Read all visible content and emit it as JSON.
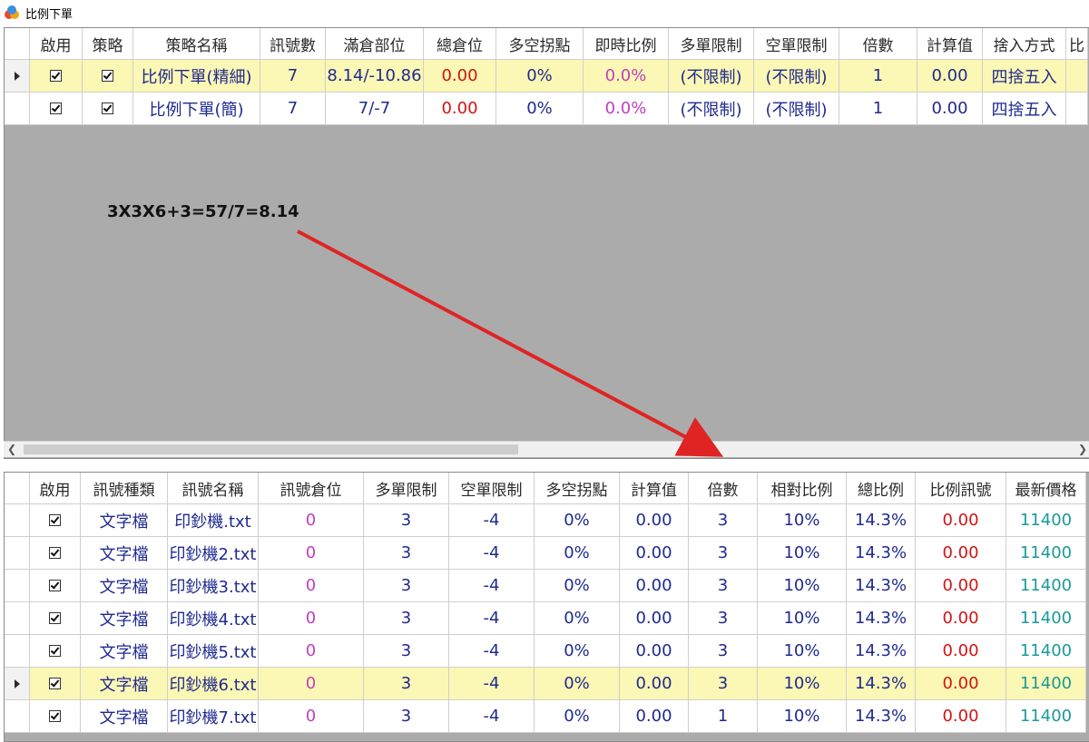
{
  "window": {
    "title": "比例下單"
  },
  "top_table": {
    "headers": [
      "啟用",
      "策略",
      "策略名稱",
      "訊號數",
      "滿倉部位",
      "總倉位",
      "多空拐點",
      "即時比例",
      "多單限制",
      "空單限制",
      "倍數",
      "計算值",
      "捨入方式",
      "比"
    ],
    "rows": [
      {
        "selected": true,
        "enabled": true,
        "strategy": true,
        "name": "比例下單(精細)",
        "signals": "7",
        "full_position": "8.14/-10.86",
        "total_position": "0.00",
        "turn_point": "0%",
        "realtime_ratio": "0.0%",
        "long_limit": "(不限制)",
        "short_limit": "(不限制)",
        "multiplier": "1",
        "calc_value": "0.00",
        "rounding": "四捨五入"
      },
      {
        "selected": false,
        "enabled": true,
        "strategy": true,
        "name": "比例下單(簡)",
        "signals": "7",
        "full_position": "7/-7",
        "total_position": "0.00",
        "turn_point": "0%",
        "realtime_ratio": "0.0%",
        "long_limit": "(不限制)",
        "short_limit": "(不限制)",
        "multiplier": "1",
        "calc_value": "0.00",
        "rounding": "四捨五入"
      }
    ]
  },
  "annotation": {
    "text": "3X3X6+3=57/7=8.14",
    "arrow_color": "#e02424"
  },
  "bottom_table": {
    "headers": [
      "啟用",
      "訊號種類",
      "訊號名稱",
      "訊號倉位",
      "多單限制",
      "空單限制",
      "多空拐點",
      "計算值",
      "倍數",
      "相對比例",
      "總比例",
      "比例訊號",
      "最新價格"
    ],
    "rows": [
      {
        "selected": false,
        "enabled": true,
        "type": "文字檔",
        "name": "印鈔機.txt",
        "position": "0",
        "long_limit": "3",
        "short_limit": "-4",
        "turn_point": "0%",
        "calc_value": "0.00",
        "multiplier": "3",
        "rel_ratio": "10%",
        "total_ratio": "14.3%",
        "ratio_signal": "0.00",
        "latest_price": "11400"
      },
      {
        "selected": false,
        "enabled": true,
        "type": "文字檔",
        "name": "印鈔機2.txt",
        "position": "0",
        "long_limit": "3",
        "short_limit": "-4",
        "turn_point": "0%",
        "calc_value": "0.00",
        "multiplier": "3",
        "rel_ratio": "10%",
        "total_ratio": "14.3%",
        "ratio_signal": "0.00",
        "latest_price": "11400"
      },
      {
        "selected": false,
        "enabled": true,
        "type": "文字檔",
        "name": "印鈔機3.txt",
        "position": "0",
        "long_limit": "3",
        "short_limit": "-4",
        "turn_point": "0%",
        "calc_value": "0.00",
        "multiplier": "3",
        "rel_ratio": "10%",
        "total_ratio": "14.3%",
        "ratio_signal": "0.00",
        "latest_price": "11400"
      },
      {
        "selected": false,
        "enabled": true,
        "type": "文字檔",
        "name": "印鈔機4.txt",
        "position": "0",
        "long_limit": "3",
        "short_limit": "-4",
        "turn_point": "0%",
        "calc_value": "0.00",
        "multiplier": "3",
        "rel_ratio": "10%",
        "total_ratio": "14.3%",
        "ratio_signal": "0.00",
        "latest_price": "11400"
      },
      {
        "selected": false,
        "enabled": true,
        "type": "文字檔",
        "name": "印鈔機5.txt",
        "position": "0",
        "long_limit": "3",
        "short_limit": "-4",
        "turn_point": "0%",
        "calc_value": "0.00",
        "multiplier": "3",
        "rel_ratio": "10%",
        "total_ratio": "14.3%",
        "ratio_signal": "0.00",
        "latest_price": "11400"
      },
      {
        "selected": true,
        "enabled": true,
        "type": "文字檔",
        "name": "印鈔機6.txt",
        "position": "0",
        "long_limit": "3",
        "short_limit": "-4",
        "turn_point": "0%",
        "calc_value": "0.00",
        "multiplier": "3",
        "rel_ratio": "10%",
        "total_ratio": "14.3%",
        "ratio_signal": "0.00",
        "latest_price": "11400"
      },
      {
        "selected": false,
        "enabled": true,
        "type": "文字檔",
        "name": "印鈔機7.txt",
        "position": "0",
        "long_limit": "3",
        "short_limit": "-4",
        "turn_point": "0%",
        "calc_value": "0.00",
        "multiplier": "1",
        "rel_ratio": "10%",
        "total_ratio": "14.3%",
        "ratio_signal": "0.00",
        "latest_price": "11400"
      }
    ]
  },
  "colors": {
    "selected_row": "#fbf7b4",
    "value_red": "#d21313",
    "value_magenta": "#c040c0",
    "value_teal": "#1a9a9a",
    "text_navy": "#1f2a8f",
    "panel_bg": "#ababab"
  }
}
